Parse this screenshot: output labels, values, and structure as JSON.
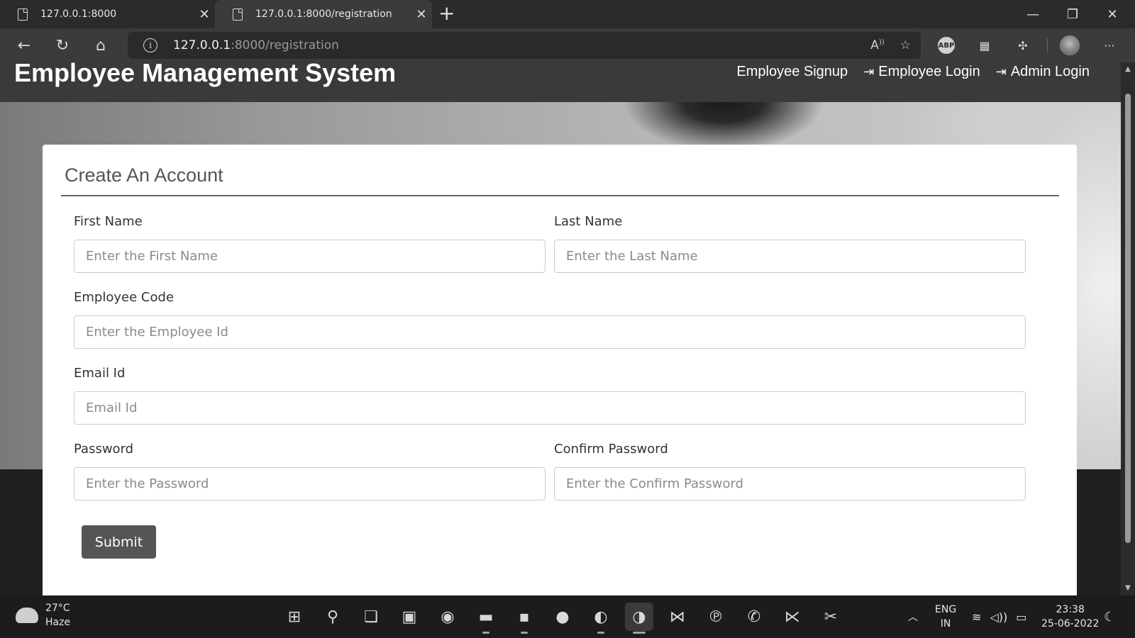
{
  "browser": {
    "tabs": [
      {
        "title": "127.0.0.1:8000",
        "active": false
      },
      {
        "title": "127.0.0.1:8000/registration",
        "active": true
      }
    ],
    "url_host": "127.0.0.1",
    "url_rest": ":8000/registration",
    "new_tab": "+",
    "window_controls": {
      "minimize": "—",
      "maximize": "❐",
      "close": "✕"
    }
  },
  "site": {
    "brand": "Employee Management System",
    "nav": [
      {
        "label": "Employee Signup",
        "icon": ""
      },
      {
        "label": "Employee Login",
        "icon": "login-icon"
      },
      {
        "label": "Admin Login",
        "icon": "login-icon"
      }
    ]
  },
  "form": {
    "title": "Create An Account",
    "fields": {
      "first_name": {
        "label": "First Name",
        "placeholder": "Enter the First Name"
      },
      "last_name": {
        "label": "Last Name",
        "placeholder": "Enter the Last Name"
      },
      "employee_code": {
        "label": "Employee Code",
        "placeholder": "Enter the Employee Id"
      },
      "email": {
        "label": "Email Id",
        "placeholder": "Email Id"
      },
      "password": {
        "label": "Password",
        "placeholder": "Enter the Password"
      },
      "confirm_password": {
        "label": "Confirm Password",
        "placeholder": "Enter the Confirm Password"
      }
    },
    "submit_label": "Submit"
  },
  "taskbar": {
    "weather": {
      "temp": "27°C",
      "condition": "Haze"
    },
    "language": {
      "line1": "ENG",
      "line2": "IN"
    },
    "time": "23:38",
    "date": "25-06-2022"
  }
}
